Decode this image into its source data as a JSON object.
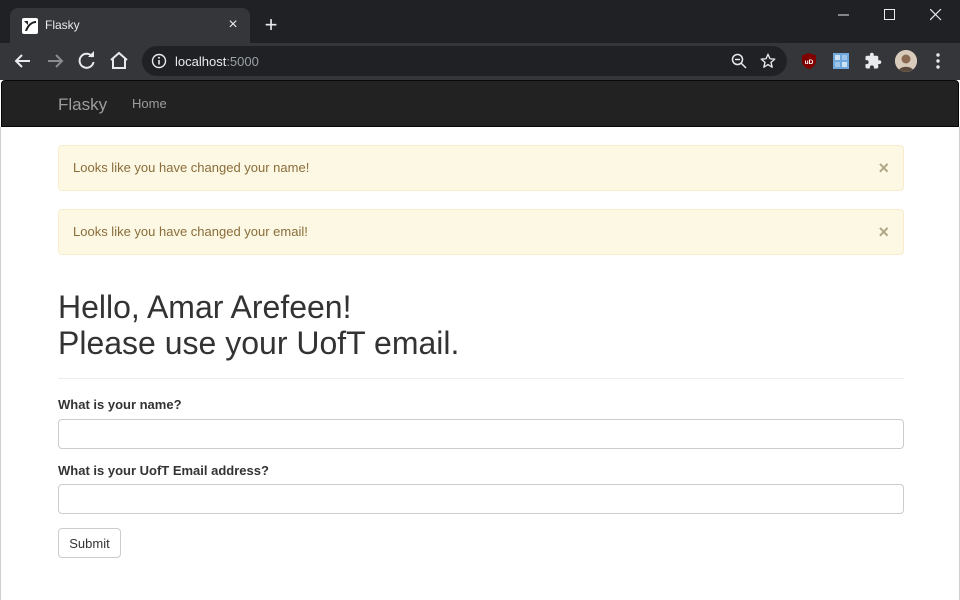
{
  "browser": {
    "tab_title": "Flasky",
    "url_host": "localhost",
    "url_port": ":5000",
    "new_tab_label": "+",
    "close_label": "×",
    "extension_ublock_label": "uD"
  },
  "navbar": {
    "brand": "Flasky",
    "home_link": "Home"
  },
  "alerts": [
    {
      "text": "Looks like you have changed your name!",
      "close": "×"
    },
    {
      "text": "Looks like you have changed your email!",
      "close": "×"
    }
  ],
  "page": {
    "heading_line1": "Hello, Amar Arefeen!",
    "heading_line2": "Please use your UofT email."
  },
  "form": {
    "name_label": "What is your name?",
    "name_value": "",
    "email_label": "What is your UofT Email address?",
    "email_value": "",
    "submit_label": "Submit"
  },
  "colors": {
    "navbar_bg": "#222222",
    "alert_warning_bg": "#fcf8e3",
    "alert_warning_text": "#8a6d3b",
    "browser_frame": "#202124"
  }
}
